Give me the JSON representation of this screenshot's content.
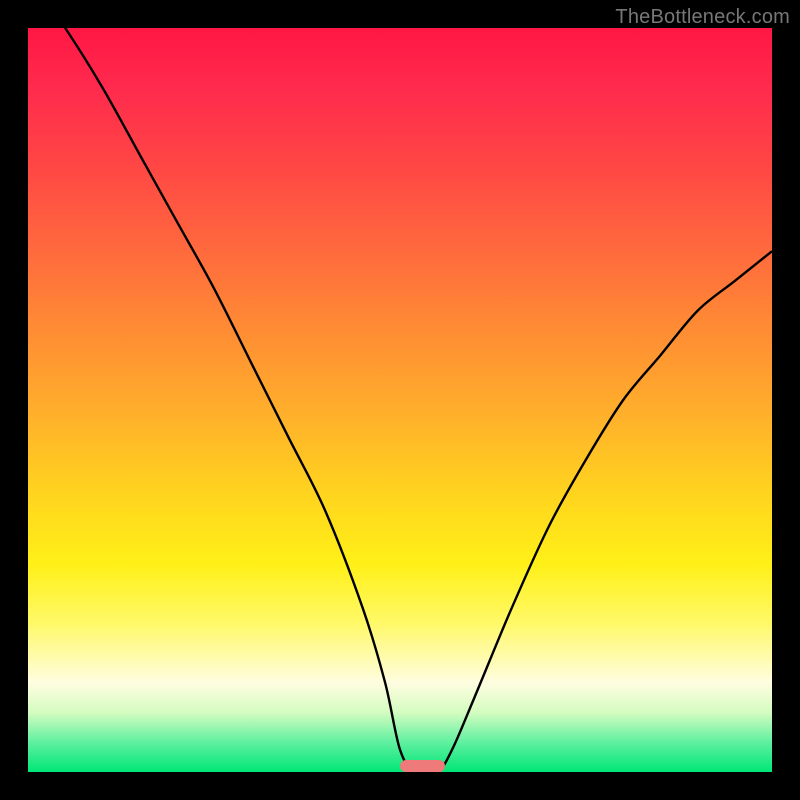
{
  "watermark": "TheBottleneck.com",
  "colors": {
    "page_bg": "#000000",
    "curve": "#000000",
    "marker": "#ef7a7a",
    "watermark_text": "#777777"
  },
  "chart_data": {
    "type": "line",
    "title": "",
    "xlabel": "",
    "ylabel": "",
    "xlim": [
      0,
      100
    ],
    "ylim": [
      0,
      100
    ],
    "x": [
      0,
      5,
      10,
      15,
      20,
      25,
      30,
      35,
      40,
      45,
      48,
      50,
      52,
      55,
      57,
      60,
      65,
      70,
      75,
      80,
      85,
      90,
      95,
      100
    ],
    "values": [
      107,
      100,
      92,
      83,
      74,
      65,
      55,
      45,
      35,
      22,
      12,
      3,
      0,
      0,
      3,
      10,
      22,
      33,
      42,
      50,
      56,
      62,
      66,
      70
    ],
    "marker": {
      "x_start": 50,
      "x_end": 56,
      "y": 0
    },
    "grid": false,
    "legend": false
  }
}
